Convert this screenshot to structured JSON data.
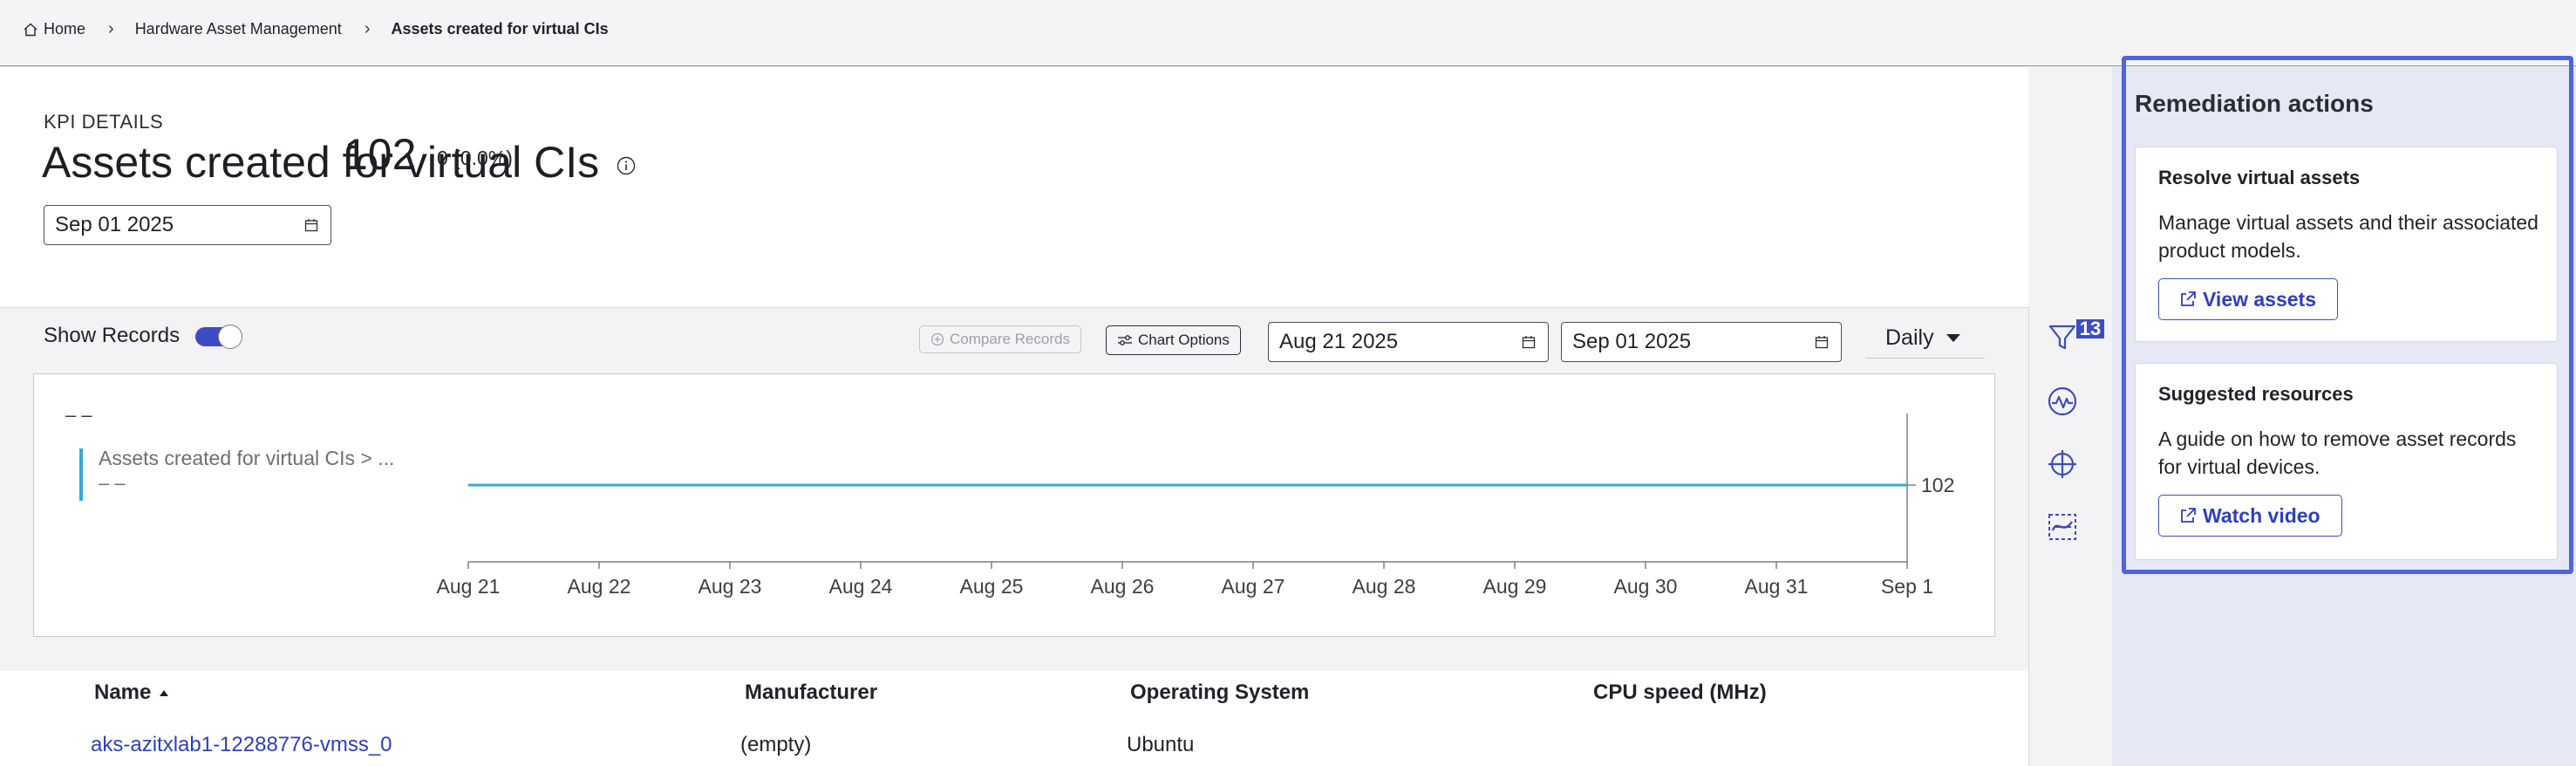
{
  "breadcrumb": {
    "items": [
      "Home",
      "Hardware Asset Management",
      "Assets created for virtual CIs"
    ]
  },
  "kpi": {
    "section_label": "KPI DETAILS",
    "title": "Assets created for virtual CIs",
    "date": "Sep 01 2025",
    "value": "102",
    "change": "0 (0.0%)"
  },
  "toolbar": {
    "show_records_label": "Show Records",
    "show_records_on": true,
    "compare_label": "Compare Records",
    "chart_options_label": "Chart Options",
    "start_date": "Aug 21 2025",
    "end_date": "Sep 01 2025",
    "interval": "Daily"
  },
  "legend": {
    "top_value": "– –",
    "series_label": "Assets created for virtual CIs > ...",
    "series_value": "– –"
  },
  "chart_data": {
    "type": "line",
    "x": [
      "Aug 21",
      "Aug 22",
      "Aug 23",
      "Aug 24",
      "Aug 25",
      "Aug 26",
      "Aug 27",
      "Aug 28",
      "Aug 29",
      "Aug 30",
      "Aug 31",
      "Sep 1"
    ],
    "series": [
      {
        "name": "Assets created for virtual CIs > ...",
        "values": [
          102,
          102,
          102,
          102,
          102,
          102,
          102,
          102,
          102,
          102,
          102,
          102
        ],
        "color": "#37a8d8"
      }
    ],
    "end_label": "102",
    "grid": false
  },
  "filters": {
    "count": "13"
  },
  "table": {
    "columns": [
      "Name",
      "Manufacturer",
      "Operating System",
      "CPU speed (MHz)"
    ],
    "sort_column": "Name",
    "rows": [
      [
        "aks-azitxlab1-12288776-vmss_0",
        "(empty)",
        "Ubuntu",
        ""
      ]
    ]
  },
  "remediation": {
    "title": "Remediation actions",
    "cards": [
      {
        "heading": "Resolve virtual assets",
        "description": "Manage virtual assets and their associated product models.",
        "button": "View assets"
      },
      {
        "heading": "Suggested resources",
        "description": "A guide on how to remove asset records for virtual devices.",
        "button": "Watch video"
      }
    ]
  },
  "colors": {
    "accent": "#3d4cc2",
    "line": "#37a8d8",
    "panel_bg": "#e7e8f5",
    "frame": "#4f64de"
  },
  "icons": [
    "home-icon",
    "chevron-right-icon",
    "info-icon",
    "calendar-icon",
    "plus-circle-icon",
    "sliders-icon",
    "caret-down-icon",
    "filter-icon",
    "activity-icon",
    "crosshair-icon",
    "trend-icon",
    "sort-up-icon",
    "external-link-icon"
  ]
}
